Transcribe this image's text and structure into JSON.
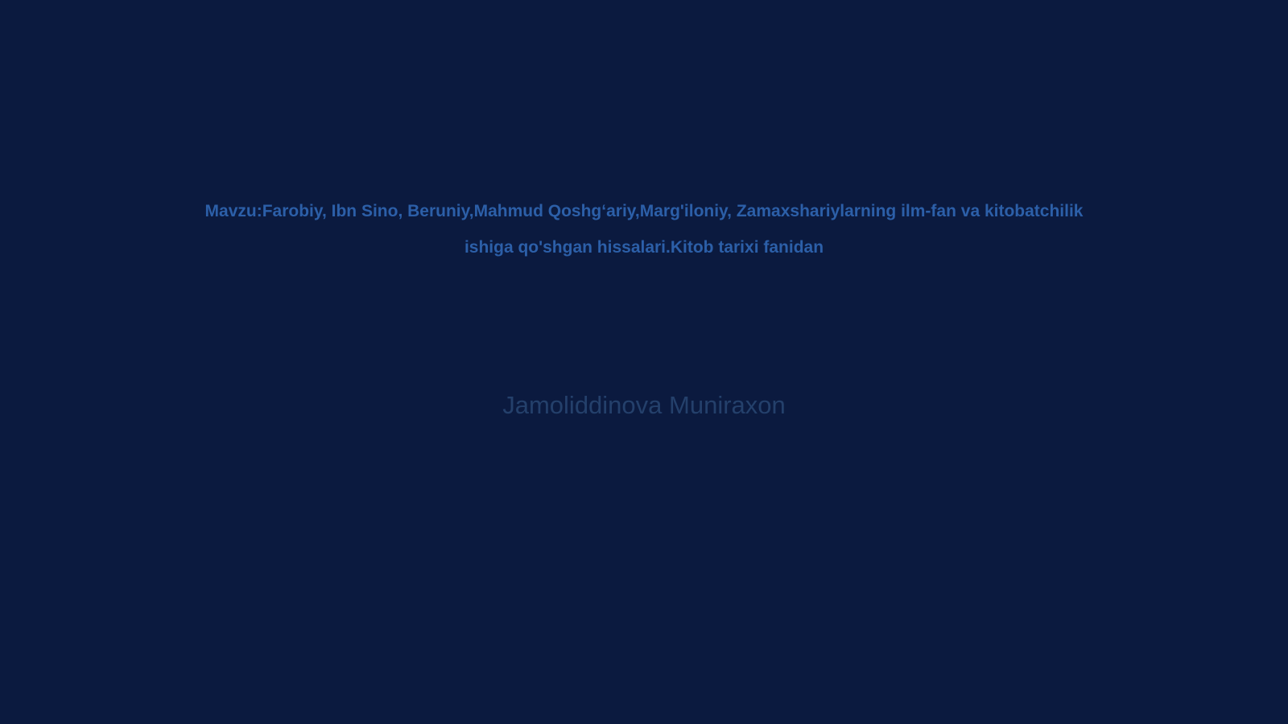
{
  "slide": {
    "title_lines": [
      "Mavzu:Farobiy, Ibn Sino, Beruniy,Mahmud Qoshgʻariy,Marg'iloniy, Zamaxshariylarning ilm-fan va kitobatchilik",
      "ishiga qo'shgan hissalari.Kitob tarixi fanidan"
    ],
    "subtitle": "Jamoliddinova Muniraxon"
  },
  "colors": {
    "background": "#0b1a3f",
    "title": "#2c5fa8",
    "subtitle": "#24406b"
  }
}
